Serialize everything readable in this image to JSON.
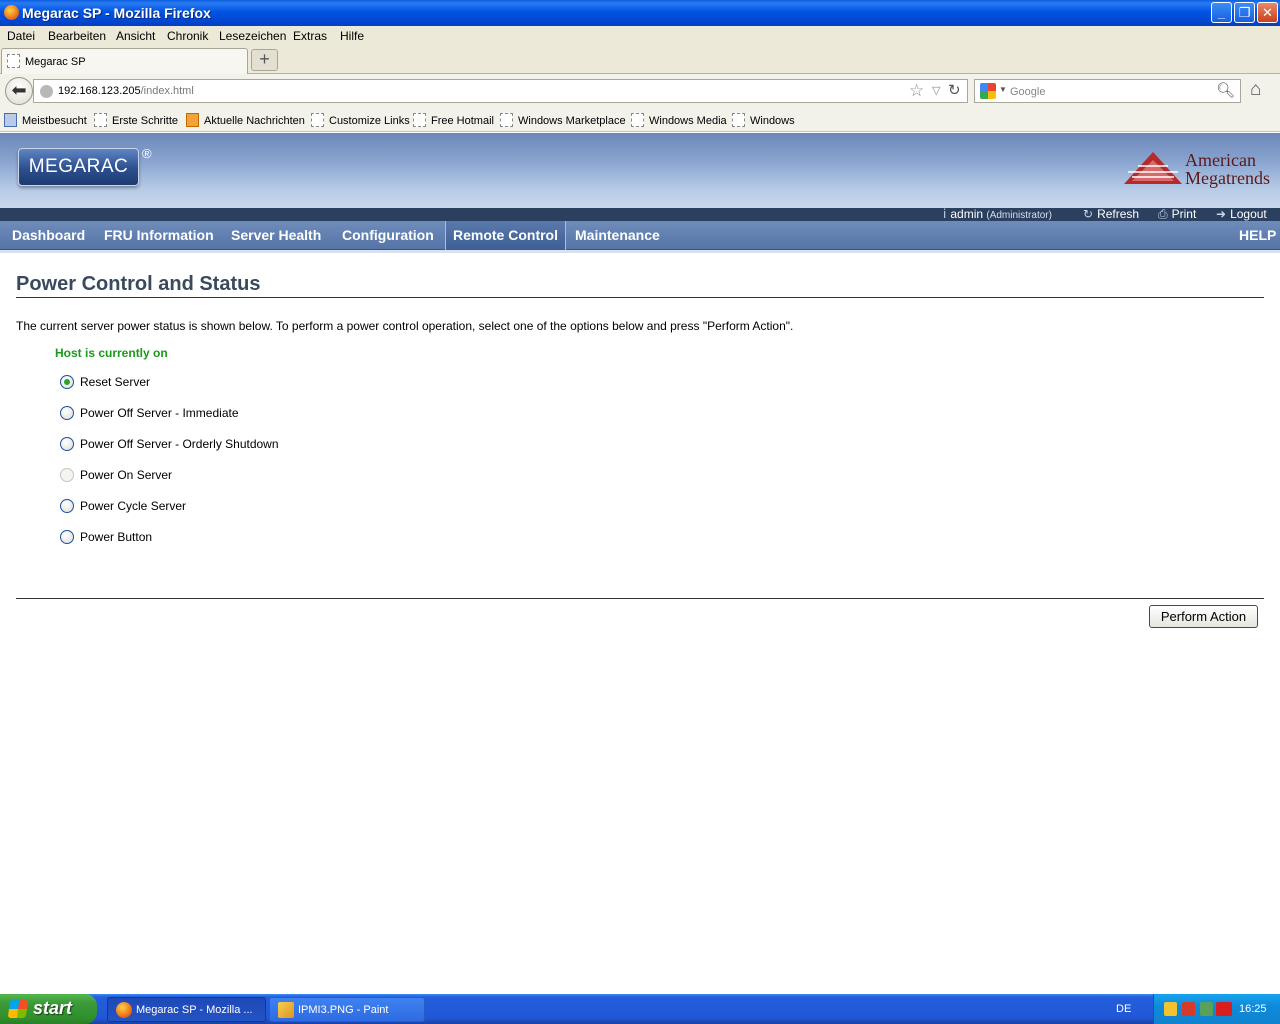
{
  "window": {
    "title": "Megarac SP - Mozilla Firefox"
  },
  "menubar": [
    "Datei",
    "Bearbeiten",
    "Ansicht",
    "Chronik",
    "Lesezeichen",
    "Extras",
    "Hilfe"
  ],
  "tab": {
    "label": "Megarac SP"
  },
  "address": {
    "host": "192.168.123.205",
    "path": "/index.html"
  },
  "search": {
    "placeholder": "Google"
  },
  "bookmarks": [
    "Meistbesucht",
    "Erste Schritte",
    "Aktuelle Nachrichten",
    "Customize Links",
    "Free Hotmail",
    "Windows Marketplace",
    "Windows Media",
    "Windows"
  ],
  "header": {
    "logo": "MEGARAC",
    "reg_mark": "®",
    "ami_line1": "American",
    "ami_line2": "Megatrends"
  },
  "userbar": {
    "user": "admin",
    "role": "(Administrator)",
    "refresh": "Refresh",
    "print": "Print",
    "logout": "Logout"
  },
  "nav": {
    "items": [
      "Dashboard",
      "FRU Information",
      "Server Health",
      "Configuration",
      "Remote Control",
      "Maintenance"
    ],
    "active": "Remote Control",
    "help": "HELP"
  },
  "content": {
    "title": "Power Control and Status",
    "description": "The current server power status is shown below. To perform a power control operation, select one of the options below and press \"Perform Action\".",
    "status": "Host is currently on",
    "options": [
      {
        "label": "Reset Server",
        "selected": true,
        "disabled": false
      },
      {
        "label": "Power Off Server - Immediate",
        "selected": false,
        "disabled": false
      },
      {
        "label": "Power Off Server - Orderly Shutdown",
        "selected": false,
        "disabled": false
      },
      {
        "label": "Power On Server",
        "selected": false,
        "disabled": true
      },
      {
        "label": "Power Cycle Server",
        "selected": false,
        "disabled": false
      },
      {
        "label": "Power Button",
        "selected": false,
        "disabled": false
      }
    ],
    "perform_button": "Perform Action"
  },
  "taskbar": {
    "start": "start",
    "tasks": [
      "Megarac SP - Mozilla ...",
      "IPMI3.PNG - Paint"
    ],
    "language": "DE",
    "clock": "16:25"
  }
}
